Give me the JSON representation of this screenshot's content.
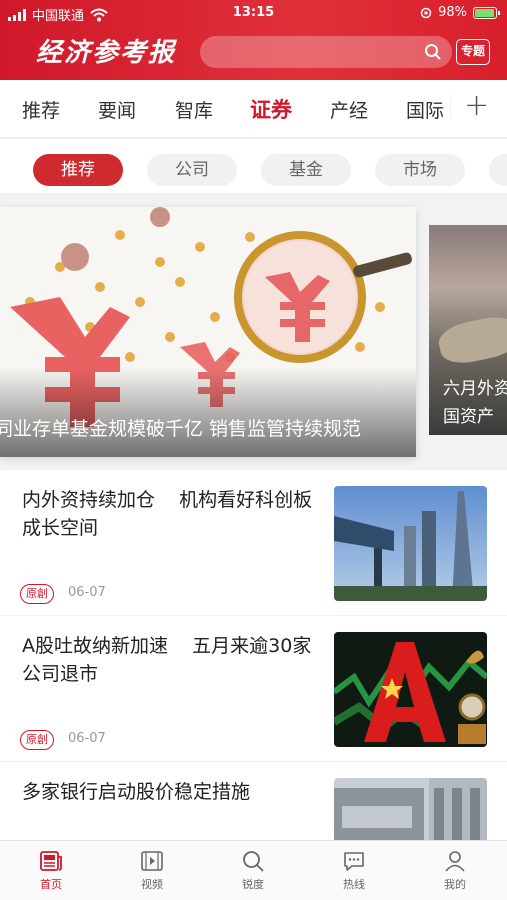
{
  "status_bar": {
    "carrier": "中国联通",
    "time": "13:15",
    "battery": "98%"
  },
  "header": {
    "logo": "经济参考报",
    "search_placeholder": "",
    "topic_button": "专题"
  },
  "channels": [
    "推荐",
    "要闻",
    "智库",
    "证券",
    "产经",
    "国际"
  ],
  "active_channel": "证券",
  "add_channel_symbol": "+",
  "subchannels": [
    "推荐",
    "公司",
    "基金",
    "市场"
  ],
  "active_subchannel": "推荐",
  "carousel": {
    "main_caption": "同业存单基金规模破千亿  销售监管持续规范",
    "side_caption": "六月外资\n国资产"
  },
  "news": [
    {
      "title": "内外资持续加仓    机构看好科创板成长空间",
      "tag": "原創",
      "date": "06-07",
      "thumb": "skyscrapers-image"
    },
    {
      "title": "A股吐故纳新加速    五月来逾30家公司退市",
      "tag": "原創",
      "date": "06-07",
      "thumb": "a-share-chart-image"
    },
    {
      "title": "多家银行启动股价稳定措施",
      "tag": "",
      "date": "",
      "thumb": "bank-building-image"
    }
  ],
  "bottom_nav": [
    {
      "label": "首页",
      "icon": "news-icon"
    },
    {
      "label": "视频",
      "icon": "video-icon"
    },
    {
      "label": "锐度",
      "icon": "search-icon"
    },
    {
      "label": "热线",
      "icon": "chat-icon"
    },
    {
      "label": "我的",
      "icon": "user-icon"
    }
  ],
  "colors": {
    "brand_red": "#d0182a",
    "active_pill": "#cf2a2e"
  }
}
